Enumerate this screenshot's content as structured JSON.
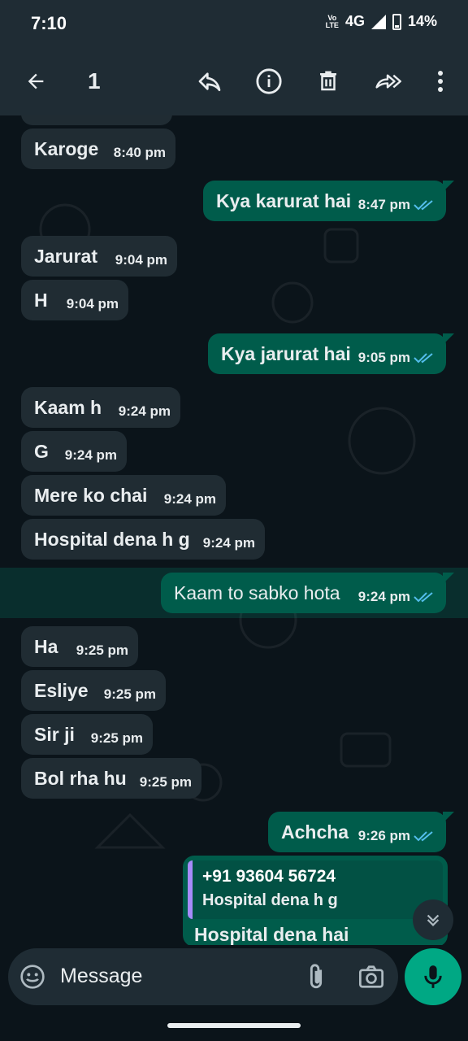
{
  "status_bar": {
    "time": "7:10",
    "network": "4G",
    "volte_top": "Vo",
    "volte_bottom": "LTE",
    "battery": "14%"
  },
  "app_bar": {
    "selected_count": "1",
    "icons": [
      "back-arrow-icon",
      "reply-icon",
      "info-icon",
      "delete-icon",
      "forward-icon",
      "more-options-icon"
    ]
  },
  "messages": [
    {
      "dir": "in",
      "text": "Karoge",
      "time": "8:40 pm"
    },
    {
      "dir": "out",
      "text": "Kya karurat hai",
      "time": "8:47 pm"
    },
    {
      "dir": "in",
      "text": "Jarurat",
      "time": "9:04 pm"
    },
    {
      "dir": "in",
      "text": "H",
      "time": "9:04 pm"
    },
    {
      "dir": "out",
      "text": "Kya jarurat hai",
      "time": "9:05 pm"
    },
    {
      "dir": "in",
      "text": "Kaam h",
      "time": "9:24 pm"
    },
    {
      "dir": "in",
      "text": "G",
      "time": "9:24 pm"
    },
    {
      "dir": "in",
      "text": "Mere ko chai",
      "time": "9:24 pm"
    },
    {
      "dir": "in",
      "text": "Hospital dena h g",
      "time": "9:24 pm"
    },
    {
      "dir": "out",
      "text": "Kaam to sabko hota",
      "time": "9:24 pm",
      "selected": true
    },
    {
      "dir": "in",
      "text": "Ha",
      "time": "9:25 pm"
    },
    {
      "dir": "in",
      "text": "Esliye",
      "time": "9:25 pm"
    },
    {
      "dir": "in",
      "text": "Sir ji",
      "time": "9:25 pm"
    },
    {
      "dir": "in",
      "text": "Bol rha hu",
      "time": "9:25 pm"
    },
    {
      "dir": "out",
      "text": "Achcha",
      "time": "9:26 pm"
    }
  ],
  "reply_message": {
    "quoted_sender": "+91 93604 56724",
    "quoted_text": "Hospital dena h g",
    "text": "Hospital dena hai"
  },
  "input": {
    "placeholder": "Message"
  },
  "colors": {
    "accent": "#00a884",
    "outgoing": "#005c4b",
    "incoming": "#202c33",
    "tick_read": "#53bdeb"
  }
}
